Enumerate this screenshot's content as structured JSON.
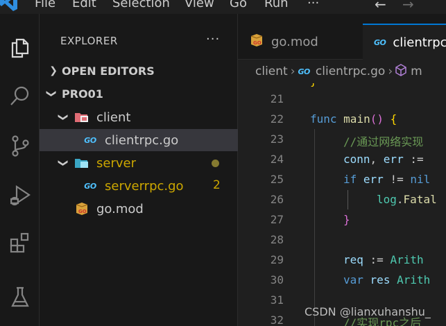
{
  "menu": {
    "items": [
      "File",
      "Edit",
      "Selection",
      "View",
      "Go",
      "Run",
      "···"
    ]
  },
  "sidebar": {
    "title": "EXPLORER",
    "more": "···",
    "open_editors": "OPEN EDITORS",
    "project": "PRO01",
    "tree": {
      "client_folder": "client",
      "client_file": "clientrpc.go",
      "server_folder": "server",
      "server_file": "serverrpc.go",
      "server_file_problems": "2",
      "gomod": "go.mod"
    }
  },
  "tabs": [
    {
      "label": "go.mod",
      "icon": "gomod-icon",
      "active": false
    },
    {
      "label": "clientrpc.go",
      "icon": "go-file-icon",
      "active": true
    }
  ],
  "breadcrumb": {
    "folder": "client",
    "file": "clientrpc.go",
    "symbol": "m"
  },
  "editor": {
    "lines": [
      {
        "num": "21",
        "text": ""
      },
      {
        "num": "22",
        "text": "func main() {"
      },
      {
        "num": "23",
        "text": "//通过网络实现"
      },
      {
        "num": "24",
        "text": "conn, err :="
      },
      {
        "num": "25",
        "text": "if err != nil"
      },
      {
        "num": "26",
        "text": "log.Fatal"
      },
      {
        "num": "27",
        "text": "}"
      },
      {
        "num": "28",
        "text": ""
      },
      {
        "num": "29",
        "text": "req := Arith"
      },
      {
        "num": "30",
        "text": "var res Arith"
      },
      {
        "num": "31",
        "text": ""
      },
      {
        "num": "32",
        "text": "//实现rpc之后"
      }
    ]
  },
  "watermark": "CSDN @lianxuhanshu_",
  "colors": {
    "accent": "#0078d4",
    "modified": "#cca700",
    "go_blue": "#4fc1ff"
  }
}
